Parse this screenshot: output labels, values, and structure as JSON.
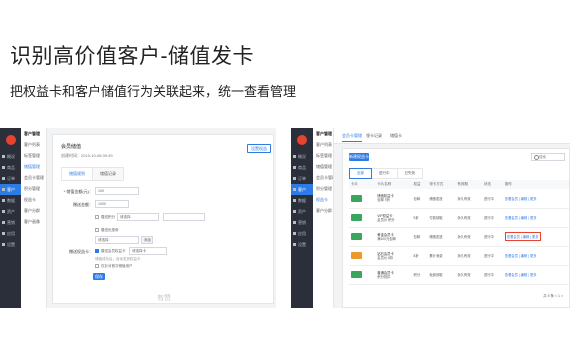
{
  "headline": "识别高价值客户-储值发卡",
  "subline": "把权益卡和客户储值行为关联起来，统一查看管理",
  "left": {
    "nav": [
      "概况",
      "商品",
      "订单",
      "客户",
      "数据",
      "资产",
      "营销",
      "应用",
      "设置"
    ],
    "nav_active": 3,
    "subnav": [
      "客户管理",
      "客户列表",
      "标签管理",
      "储值管理",
      "会员卡管理",
      "积分管理",
      "权益卡",
      "客户分群",
      "客户画像"
    ],
    "panel_title": "会员储值",
    "panel_date": "创建时间：2019-10-08 09:39",
    "top_button": "设置权益",
    "tabs": [
      "储值规则",
      "储值记录"
    ],
    "form": {
      "amount_label": "* 储值金额(元)：",
      "amount_value": "100",
      "gift_label": "赠送金额：",
      "gift_value": "1000",
      "opt1": "赠送积分",
      "opt1_select": "请选择",
      "opt2": "赠送优惠券",
      "opt3_placeholder": "请选择",
      "opt3_btn": "添加",
      "card_label": "赠送权益卡：",
      "card_check": "赠送会员权益卡",
      "card_select": "请选择卡",
      "card_note": "储值成功后，自动发放权益卡",
      "card_check2": "仅针对首次储值用户",
      "save": "保存"
    },
    "watermark": "有赞"
  },
  "right": {
    "nav": [
      "概况",
      "商品",
      "订单",
      "客户",
      "数据",
      "资产",
      "营销",
      "应用",
      "设置"
    ],
    "nav_active": 3,
    "subnav": [
      "客户管理",
      "客户列表",
      "标签管理",
      "储值管理",
      "会员卡管理",
      "积分管理",
      "权益卡",
      "客户分群"
    ],
    "top_tabs": [
      "会员卡管理",
      "领卡记录",
      "储值卡"
    ],
    "search_placeholder": "搜索",
    "add_button": "新建权益卡",
    "sub_tabs": [
      "全部",
      "进行中",
      "已失效"
    ],
    "columns": [
      "卡片",
      "卡片名称",
      "权益",
      "领卡方式",
      "有效期",
      "状态",
      "操作"
    ],
    "rows": [
      {
        "color": "#3aa55d",
        "name": "储值权益卡",
        "desc": "包邮 9折",
        "perk": "包邮",
        "method": "储值发放",
        "valid": "永久有效",
        "status": "进行中",
        "ops": "查看会员 | 编辑 | 更多"
      },
      {
        "color": "#3aa55d",
        "name": "VIP权益卡",
        "desc": "会员价 积分",
        "perk": "9折",
        "method": "付费领取",
        "valid": "永久有效",
        "status": "进行中",
        "ops": "查看会员 | 编辑 | 更多"
      },
      {
        "color": "#3aa55d",
        "name": "黄金会员卡",
        "desc": "满100元包邮",
        "perk": "包邮",
        "method": "储值发放",
        "valid": "永久有效",
        "status": "进行中",
        "ops": "查看会员 | 编辑 | 更多",
        "highlight": true
      },
      {
        "color": "#e89a2c",
        "name": "钻石会员卡",
        "desc": "会员价 8折",
        "perk": "8折",
        "method": "累计消费",
        "valid": "永久有效",
        "status": "进行中",
        "ops": "查看会员 | 编辑 | 更多"
      },
      {
        "color": "#3aa55d",
        "name": "普通会员卡",
        "desc": "积分抵扣",
        "perk": "积分",
        "method": "免费领取",
        "valid": "永久有效",
        "status": "进行中",
        "ops": "查看会员 | 编辑 | 更多"
      }
    ],
    "pager": "共 5 条  < 1 >"
  }
}
